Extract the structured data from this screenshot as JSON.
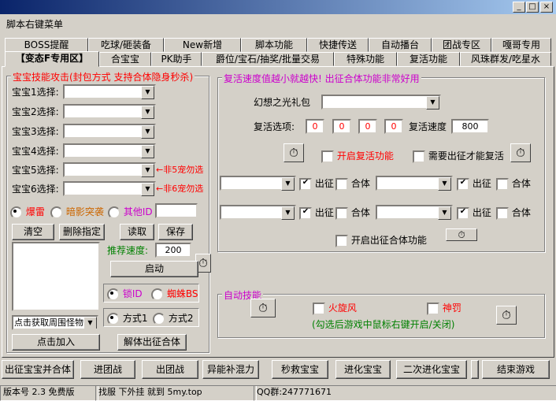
{
  "window": {
    "min_icon": "minimize-icon",
    "max_icon": "maximize-icon",
    "close_icon": "close-icon",
    "min_glyph": "_",
    "max_glyph": "□",
    "close_glyph": "×"
  },
  "menu": {
    "title": "脚本右键菜单"
  },
  "tabs_row1": [
    "BOSS提醒",
    "吃球/砸装备",
    "New新增",
    "脚本功能",
    "快捷传送",
    "自动播台",
    "团战专区",
    "嘎哥专用"
  ],
  "tabs_row2": [
    "【变态F专用区】",
    "合宝宝",
    "PK助手",
    "爵位/宝石/抽奖/批量交易",
    "特殊功能",
    "复活功能",
    "风珠群发/吃星水"
  ],
  "left_group": {
    "legend": "宝宝技能攻击(封包方式 支持合体隐身秒杀)",
    "selects": [
      "宝宝1选择:",
      "宝宝2选择:",
      "宝宝3选择:",
      "宝宝4选择:",
      "宝宝5选择:",
      "宝宝6选择:"
    ],
    "note5": "←非5宠勿选",
    "note6": "←非6宠勿选",
    "radio_thunder": "爆雷",
    "radio_shadow": "暗影突袭",
    "radio_other": "其他ID",
    "btn_clear": "清空",
    "btn_delete": "删除指定",
    "btn_read": "读取",
    "btn_save": "保存",
    "speed_label": "推荐速度:",
    "speed_value": "200",
    "btn_start": "启动",
    "radio_lock": "锁ID",
    "radio_spider": "蜘蛛BS",
    "combo_monster": "点击获取周围怪物",
    "radio_mode1": "方式1",
    "radio_mode2": "方式2",
    "btn_add": "点击加入",
    "btn_unmerge": "解体出征合体"
  },
  "revive_group": {
    "legend": "复活速度值越小就越快! 出征合体功能非常好用",
    "gift_label": "幻想之光礼包",
    "revive_label": "复活选项:",
    "revive_values": [
      "0",
      "0",
      "0",
      "0"
    ],
    "speed_label": "复活速度",
    "speed_value": "800",
    "chk_revive": "开启复活功能",
    "chk_need": "需要出征才能复活",
    "go_label": "出征",
    "merge_label": "合体",
    "chk_merge": "开启出征合体功能"
  },
  "auto_group": {
    "legend": "自动技能",
    "chk_whirlwind": "火旋风",
    "chk_punish": "神罚",
    "hint": "(勾选后游戏中鼠标右键开启/关闭)"
  },
  "bottom_buttons": [
    "出征宝宝并合体",
    "进团战",
    "出团战",
    "异能补混力",
    "秒救宝宝",
    "进化宝宝",
    "二次进化宝宝",
    "结束游戏"
  ],
  "status": {
    "version": "版本号 2.3 免费版",
    "find": "找服 下外挂 就到  5my.top",
    "qq": "QQ群:247771671"
  },
  "icons": {
    "timer": "stopwatch-icon",
    "timer_glyph": "⏱",
    "arrow_glyph": "▼"
  }
}
